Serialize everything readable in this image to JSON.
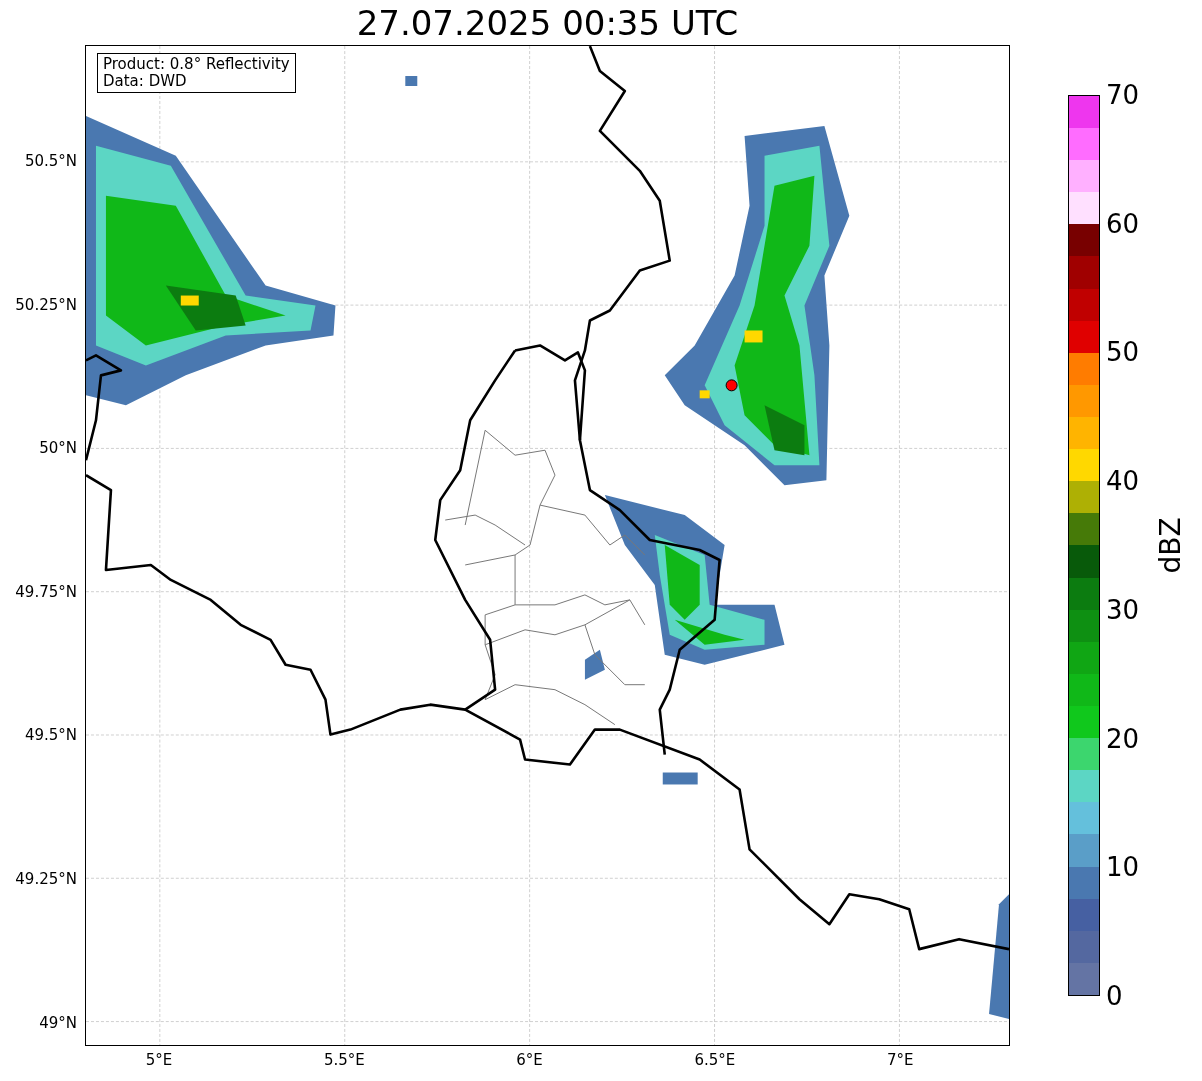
{
  "title": "27.07.2025 00:35 UTC",
  "legend": [
    "Product: 0.8° Reflectivity",
    "Data: DWD"
  ],
  "lat_ticks": [
    "50.5°N",
    "50.25°N",
    "50°N",
    "49.75°N",
    "49.5°N",
    "49.25°N",
    "49°N"
  ],
  "lon_ticks": [
    "5°E",
    "5.5°E",
    "6°E",
    "6.5°E",
    "7°E"
  ],
  "colorbar": {
    "label": "dBZ",
    "ticks": [
      "70",
      "60",
      "50",
      "40",
      "30",
      "20",
      "10",
      "0"
    ],
    "bins": [
      {
        "color": "#6474a4"
      },
      {
        "color": "#5468a0"
      },
      {
        "color": "#4660a2"
      },
      {
        "color": "#4a78b0"
      },
      {
        "color": "#5a9ec8"
      },
      {
        "color": "#64c0dc"
      },
      {
        "color": "#5cd6c4"
      },
      {
        "color": "#3cd66e"
      },
      {
        "color": "#10c81c"
      },
      {
        "color": "#10b818"
      },
      {
        "color": "#10a614"
      },
      {
        "color": "#0e9012"
      },
      {
        "color": "#0c7c10"
      },
      {
        "color": "#085a0a"
      },
      {
        "color": "#467a08"
      },
      {
        "color": "#aeb004"
      },
      {
        "color": "#ffd800"
      },
      {
        "color": "#ffb400"
      },
      {
        "color": "#ff9800"
      },
      {
        "color": "#ff7c00"
      },
      {
        "color": "#e00000"
      },
      {
        "color": "#c00000"
      },
      {
        "color": "#a00000"
      },
      {
        "color": "#780000"
      },
      {
        "color": "#ffe0ff"
      },
      {
        "color": "#ffb0ff"
      },
      {
        "color": "#ff6cff"
      },
      {
        "color": "#ee36ee"
      }
    ]
  }
}
